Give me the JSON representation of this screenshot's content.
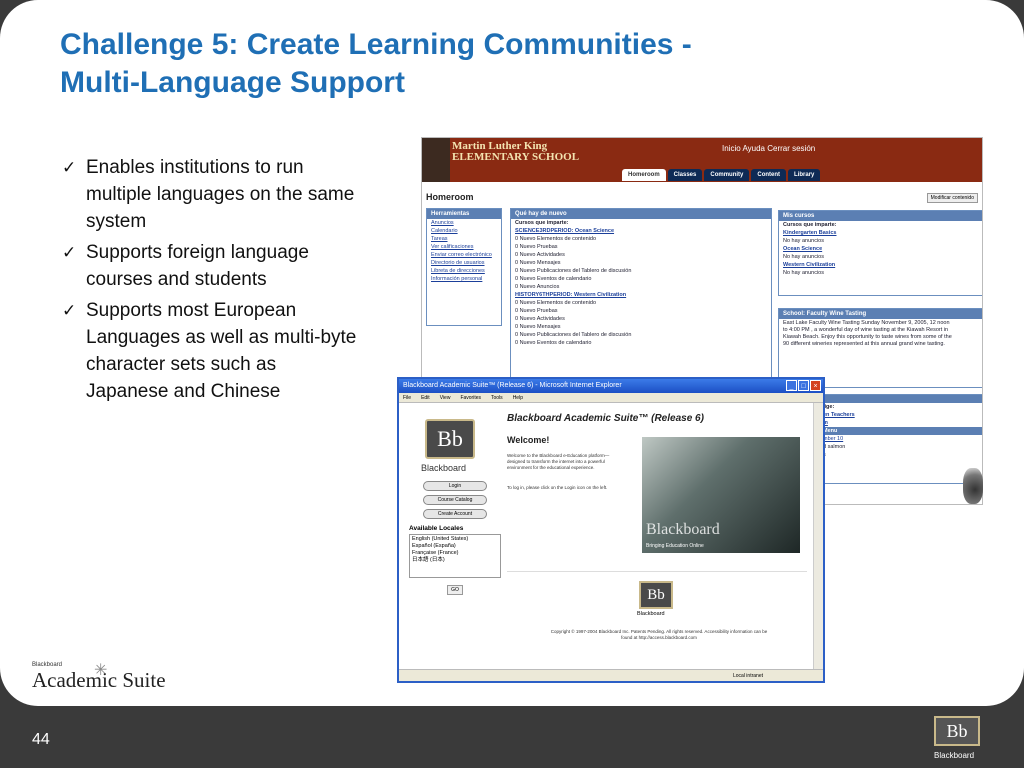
{
  "slide": {
    "title_line1": "Challenge 5: Create Learning Communities -",
    "title_line2": "Multi-Language Support",
    "bullets": [
      "Enables institutions to run multiple languages on the same system",
      "Supports foreign language courses and students",
      "Supports most European Languages as well as multi-byte character sets such as Japanese and Chinese"
    ],
    "page_number": "44",
    "footer_brand_small": "Blackboard",
    "footer_brand_big": "Academic Suite",
    "corner_brand": "Blackboard",
    "corner_logo": "Bb",
    "check_glyph": "✓"
  },
  "school": {
    "name_line1": "Martin Luther King",
    "name_line2": "ELEMENTARY SCHOOL",
    "icon_labels": "Inicio  Ayuda  Cerrar sesión",
    "tabs": [
      "Homeroom",
      "Classes",
      "Community",
      "Content",
      "Library"
    ],
    "page_title": "Homeroom",
    "modify_button": "Modificar contenido",
    "tools_header": "Herramientas",
    "tools": [
      "Anuncios",
      "Calendario",
      "Tareas",
      "Ver calificaciones",
      "Enviar correo electrónico",
      "Directorio de usuarios",
      "Libreta de direcciones",
      "Información personal"
    ],
    "news_header": "Qué hay de nuevo",
    "news_lines": [
      "Cursos que imparte:",
      "SCIENCE3RDPERIOD: Ocean Science",
      "0 Nuevo Elementos de contenido",
      "0 Nuevo Pruebas",
      "0 Nuevo Actividades",
      "0 Nuevo Mensajes",
      "0 Nuevo Publicaciones del Tablero de discusión",
      "0 Nuevo Eventos de calendario",
      "0 Nuevo Anuncios",
      "HISTORY6THPERIOD: Western Civilization",
      "0 Nuevo Elementos de contenido",
      "0 Nuevo Pruebas",
      "0 Nuevo Actividades",
      "0 Nuevo Mensajes",
      "0 Nuevo Publicaciones del Tablero de discusión",
      "0 Nuevo Eventos de calendario"
    ],
    "courses_header": "Mis cursos",
    "courses_lines": [
      "Cursos que imparte:",
      "Kindergarten Basics",
      "No hay anuncios",
      "Ocean Science",
      "No hay anuncios",
      "Western Civilization",
      "No hay anuncios"
    ],
    "faculty_header": "School: Faculty Wine Tasting",
    "faculty_text": "East Lake Faculty Wine Tasting Sunday November 9, 2005, 12 noon to 4:00 PM , a wonderful day of wine tasting at the Kiawah Resort in Kiawah Beach. Enjoy this opportunity to taste wines from some of the 90 different wineries represented at this annual grand wine tasting.",
    "partial_lines": [
      "lige:",
      "en Teachers",
      "m",
      "Menu",
      "mber 10",
      "d salmon",
      "s"
    ]
  },
  "window": {
    "title": "Blackboard Academic Suite™ (Release 6) - Microsoft Internet Explorer",
    "menu": [
      "File",
      "Edit",
      "View",
      "Favorites",
      "Tools",
      "Help"
    ],
    "logo": "Bb",
    "logo_word": "Blackboard",
    "buttons": [
      "Login",
      "Course Catalog",
      "Create Account"
    ],
    "locales_header": "Available Locales",
    "locales": [
      "English (United States)",
      "Español (España)",
      "Française (France)",
      "日本語 (日本)"
    ],
    "go_button": "GO",
    "main_title": "Blackboard Academic Suite™ (Release 6)",
    "welcome": "Welcome!",
    "welcome_text": "Welcome to the Blackboard e-Education platform—designed to transform the internet into a powerful environment for the educational experience.",
    "login_text": "To log in, please click on the Login icon on the left.",
    "hero_logo": "Blackboard",
    "hero_sub": "Bringing Education Online",
    "copyright": "Copyright © 1997-2004 Blackboard Inc. Patents Pending. All rights reserved. Accessibility information can be found at http://access.blackboard.com",
    "status": "Local intranet"
  }
}
